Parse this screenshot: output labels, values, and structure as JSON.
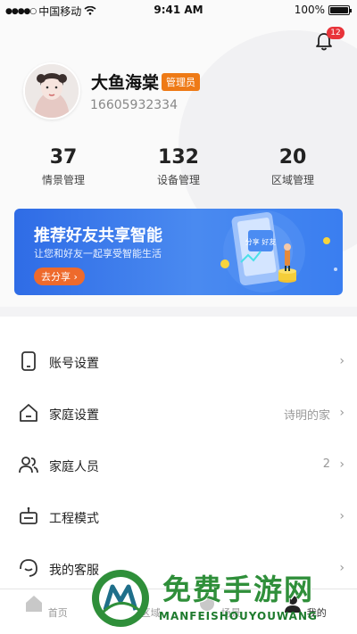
{
  "status_bar": {
    "carrier": "中国移动",
    "time": "9:41 AM",
    "battery": "100%"
  },
  "notifications": {
    "count": "12"
  },
  "user": {
    "name": "大鱼海棠",
    "role": "管理员",
    "phone": "16605932334"
  },
  "stats": [
    {
      "value": "37",
      "label": "情景管理"
    },
    {
      "value": "132",
      "label": "设备管理"
    },
    {
      "value": "20",
      "label": "区域管理"
    }
  ],
  "banner": {
    "title": "推荐好友共享智能",
    "subtitle": "让您和好友一起享受智能生活",
    "cta": "去分享 ›",
    "illustration_text": "分享 好友"
  },
  "menu": [
    {
      "label": "账号设置",
      "value": "",
      "icon": "phone-icon"
    },
    {
      "label": "家庭设置",
      "value": "诗明的家",
      "icon": "home-icon"
    },
    {
      "label": "家庭人员",
      "value": "2",
      "icon": "people-icon"
    },
    {
      "label": "工程模式",
      "value": "",
      "icon": "robot-icon"
    },
    {
      "label": "我的客服",
      "value": "",
      "icon": "support-icon"
    }
  ],
  "tabs": [
    {
      "label": "首页",
      "icon": "home-icon"
    },
    {
      "label": "区域",
      "icon": "area-icon"
    },
    {
      "label": "场景",
      "icon": "scene-icon"
    },
    {
      "label": "我的",
      "icon": "profile-icon"
    }
  ],
  "watermark": {
    "title": "免费手游网",
    "subtitle": "MANFEISHOUYOUWANG"
  },
  "colors": {
    "accent_orange": "#ee7a16",
    "banner_blue": "#3a7ef0",
    "badge_red": "#e8343a"
  }
}
